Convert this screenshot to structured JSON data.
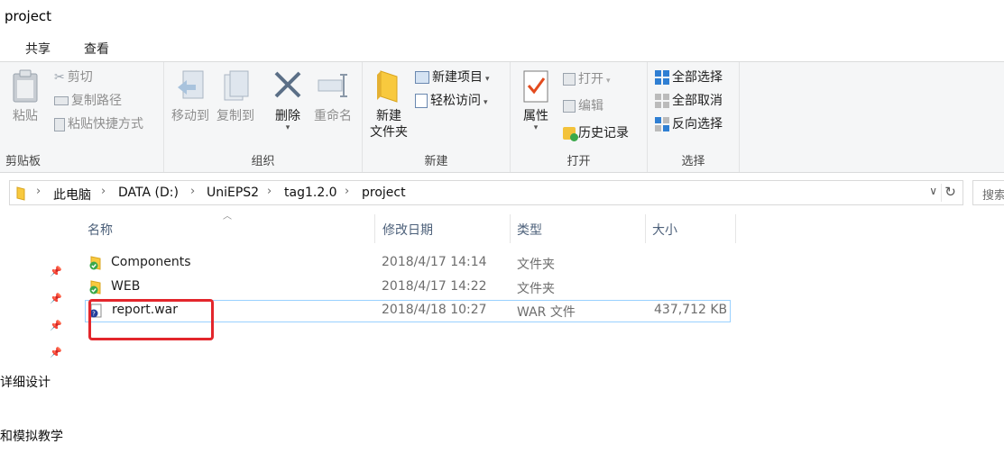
{
  "window": {
    "title": "project"
  },
  "ribbon_tabs": [
    {
      "label": "共享"
    },
    {
      "label": "查看"
    }
  ],
  "ribbon": {
    "clipboard": {
      "label": "剪贴板",
      "paste": "粘贴",
      "cut": "剪切",
      "copy_path": "复制路径",
      "paste_shortcut": "粘贴快捷方式"
    },
    "organize": {
      "label": "组织",
      "move_to": "移动到",
      "copy_to": "复制到",
      "delete": "删除",
      "rename": "重命名"
    },
    "new": {
      "label": "新建",
      "new_folder_line1": "新建",
      "new_folder_line2": "文件夹",
      "new_item": "新建项目",
      "easy_access": "轻松访问"
    },
    "open": {
      "label": "打开",
      "properties": "属性",
      "open": "打开",
      "edit": "编辑",
      "history": "历史记录"
    },
    "select": {
      "label": "选择",
      "select_all": "全部选择",
      "select_none": "全部取消",
      "invert": "反向选择"
    }
  },
  "address": {
    "crumbs": [
      "此电脑",
      "DATA (D:)",
      "UniEPS2",
      "tag1.2.0",
      "project"
    ],
    "search_placeholder": "搜索"
  },
  "nav_pane": {
    "items": [
      "详细设计",
      "和模拟教学"
    ]
  },
  "columns": {
    "name": "名称",
    "date": "修改日期",
    "type": "类型",
    "size": "大小"
  },
  "files": [
    {
      "name": "Components",
      "date": "2018/4/17 14:14",
      "type": "文件夹",
      "size": "",
      "kind": "folder"
    },
    {
      "name": "WEB",
      "date": "2018/4/17 14:22",
      "type": "文件夹",
      "size": "",
      "kind": "folder"
    },
    {
      "name": "report.war",
      "date": "2018/4/18 10:27",
      "type": "WAR 文件",
      "size": "437,712 KB",
      "kind": "unknown-file"
    }
  ],
  "colors": {
    "accent": "#0078d7",
    "highlight_box": "#e3262c",
    "selection_border": "#99d1ff",
    "header_text": "#4c607a"
  }
}
